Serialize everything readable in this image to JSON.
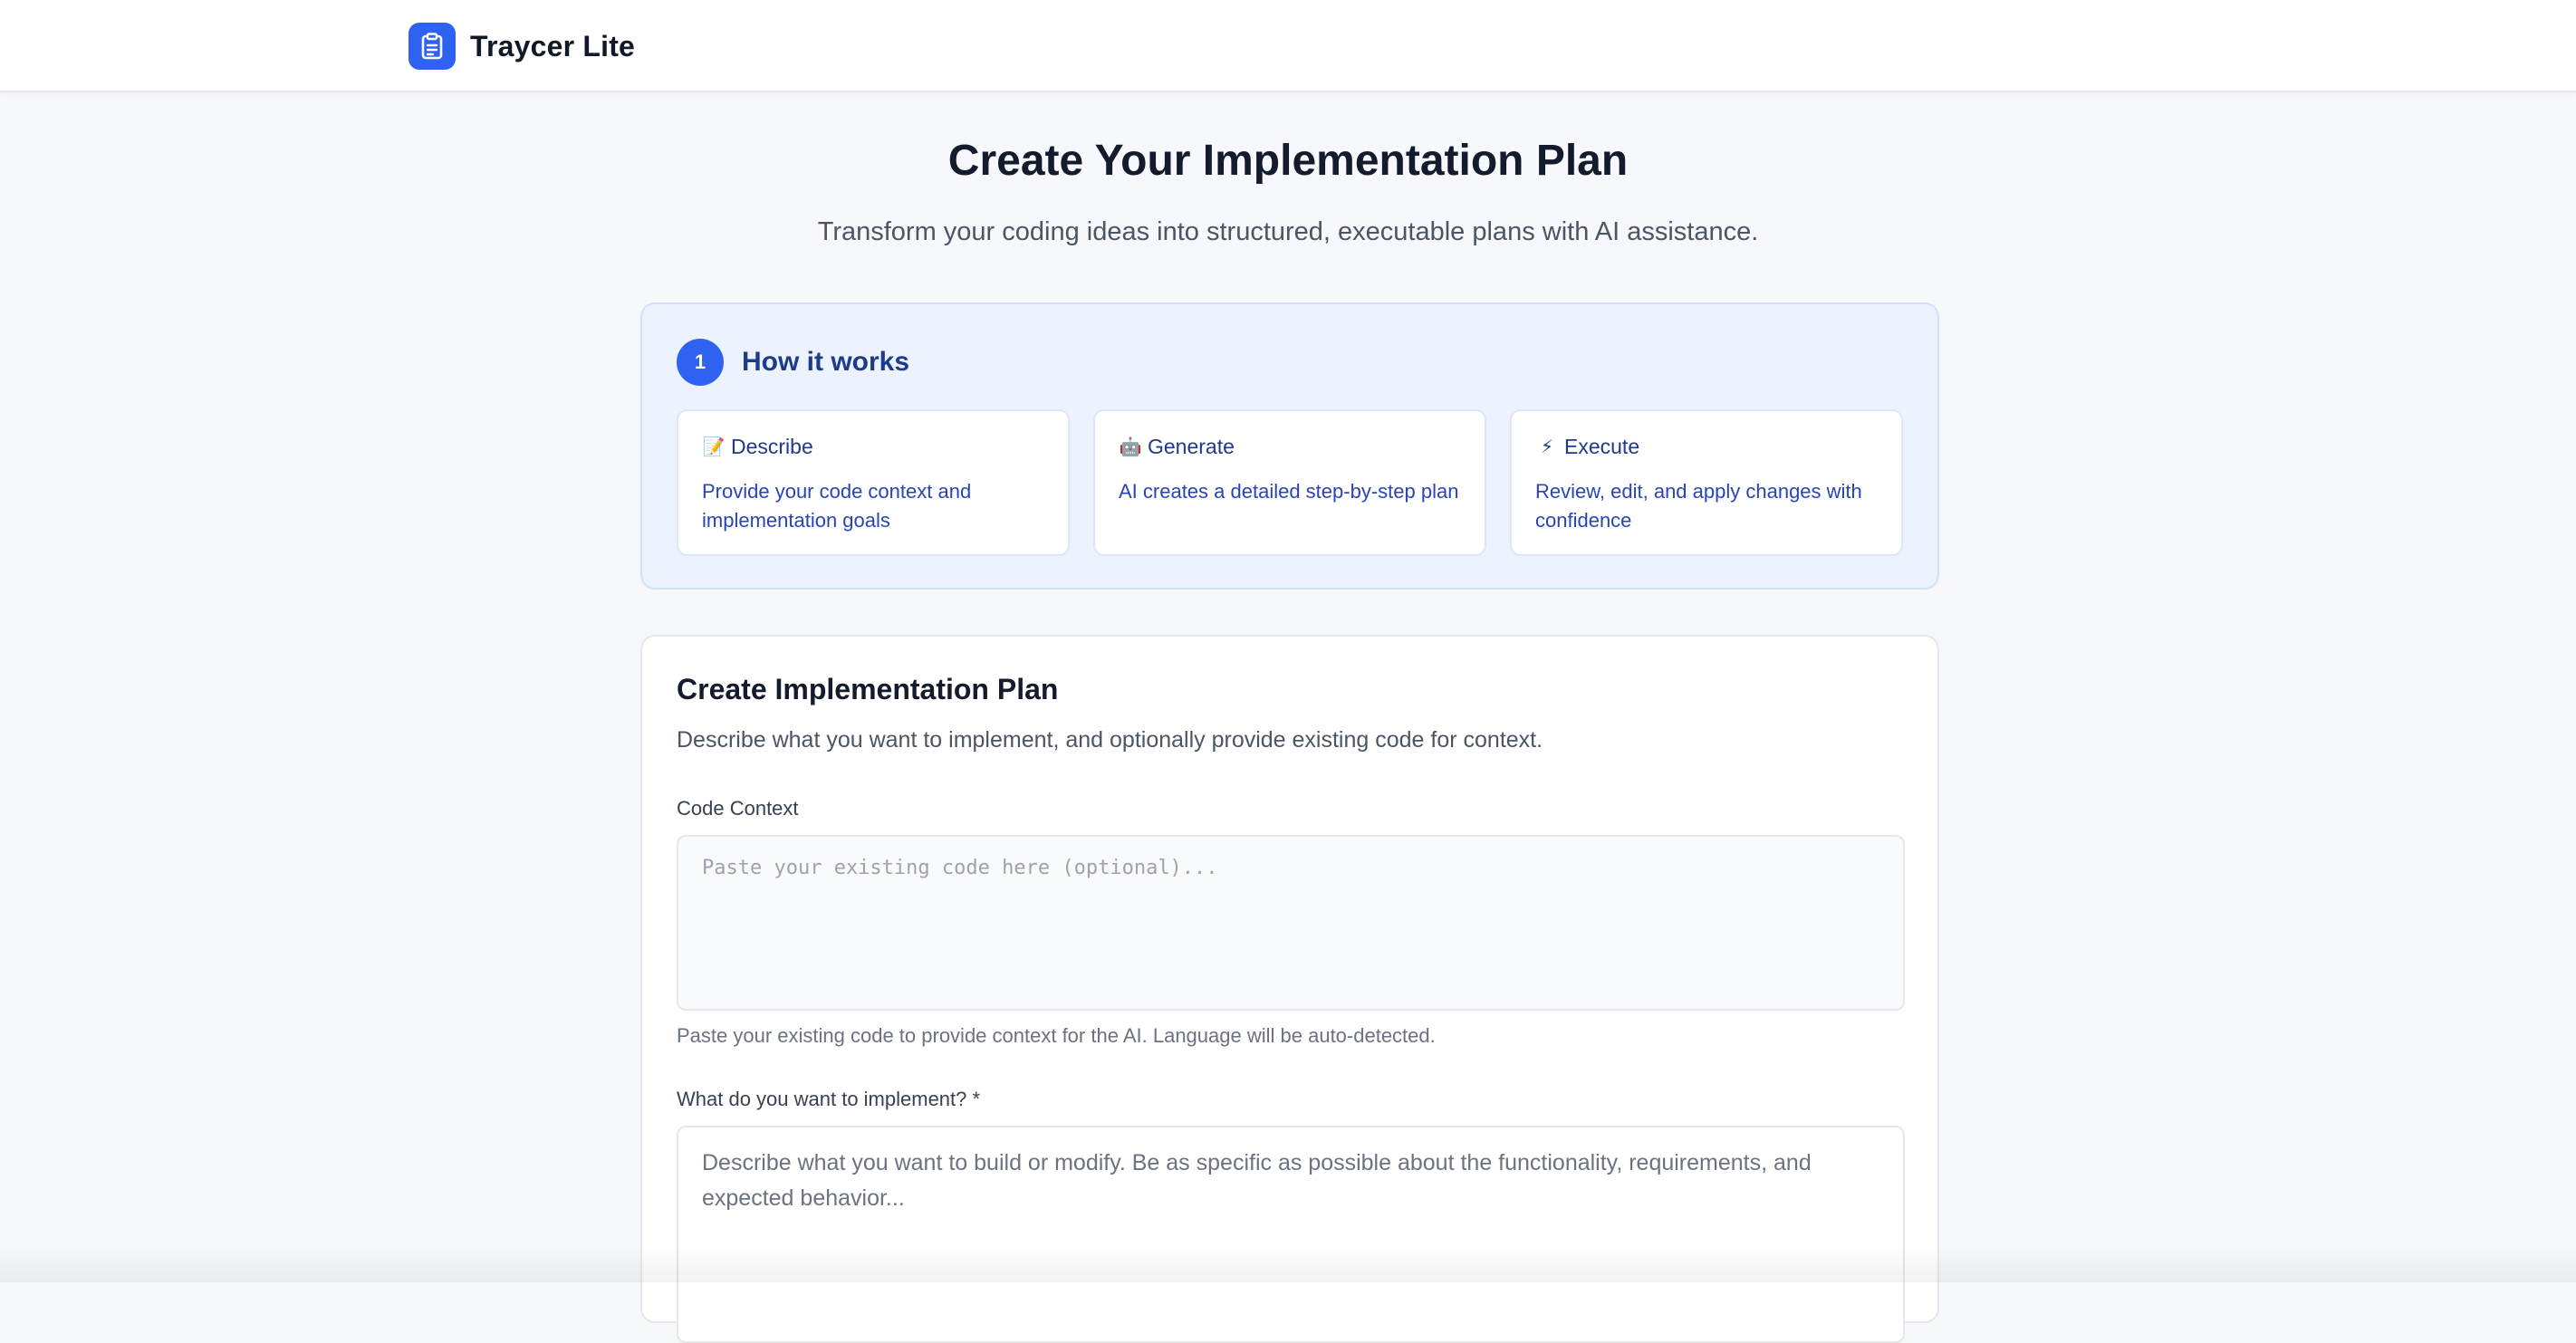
{
  "app": {
    "name": "Traycer Lite",
    "logo_icon": "clipboard-icon",
    "brand_color": "#2f62f2"
  },
  "hero": {
    "title": "Create Your Implementation Plan",
    "subtitle": "Transform your coding ideas into structured, executable plans with AI assistance."
  },
  "how_it_works": {
    "step_number": "1",
    "title": "How it works",
    "steps": [
      {
        "emoji": "📝",
        "icon": "memo-icon",
        "title": "Describe",
        "description": "Provide your code context and implementation goals"
      },
      {
        "emoji": "🤖",
        "icon": "robot-icon",
        "title": "Generate",
        "description": "AI creates a detailed step-by-step plan"
      },
      {
        "emoji": "⚡",
        "icon": "lightning-icon",
        "title": "Execute",
        "description": "Review, edit, and apply changes with confidence"
      }
    ]
  },
  "form": {
    "title": "Create Implementation Plan",
    "subtitle": "Describe what you want to implement, and optionally provide existing code for context.",
    "code_context": {
      "label": "Code Context",
      "value": "",
      "placeholder": "Paste your existing code here (optional)...",
      "help": "Paste your existing code to provide context for the AI. Language will be auto-detected."
    },
    "implementation": {
      "label": "What do you want to implement? *",
      "value": "",
      "placeholder": "Describe what you want to build or modify. Be as specific as possible about the functionality, requirements, and expected behavior..."
    }
  }
}
